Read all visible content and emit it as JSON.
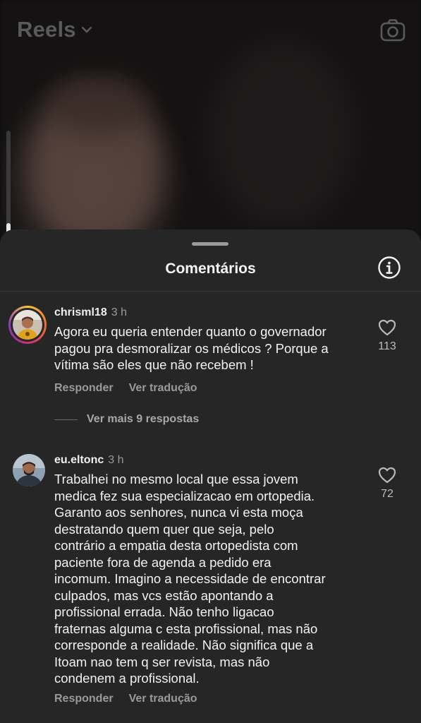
{
  "header": {
    "title": "Reels"
  },
  "sheet": {
    "title": "Comentários"
  },
  "comments": [
    {
      "username": "chrisml18",
      "time": "3 h",
      "text": "Agora eu queria entender quanto o governador\npagou pra desmoralizar os médicos ? Porque a\nvítima são eles que não recebem !",
      "likes": "113",
      "reply_label": "Responder",
      "translate_label": "Ver tradução",
      "more_replies": "Ver mais 9 respostas"
    },
    {
      "username": "eu.eltonc",
      "time": "3 h",
      "text": "Trabalhei no mesmo local que essa jovem\nmedica fez sua especializacao em ortopedia.\nGaranto aos senhores, nunca vi esta moça\ndestratando quem quer que seja, pelo\ncontrário a empatia desta ortopedista com\npaciente fora de agenda a pedido era\nincomum. Imagino a necessidade de encontrar\nculpados, mas vcs estão apontando a\nprofissional errada. Não tenho ligacao\nfraternas alguma c esta profissional,  mas não\ncorresponde a realidade. Não significa que a\nItoam nao tem q ser revista, mas não\ncondenem a profissional.",
      "likes": "72",
      "reply_label": "Responder",
      "translate_label": "Ver tradução"
    }
  ],
  "icons": {
    "chevron": "chevron-down-icon",
    "camera": "camera-icon",
    "info": "info-icon",
    "like": "heart-icon"
  }
}
